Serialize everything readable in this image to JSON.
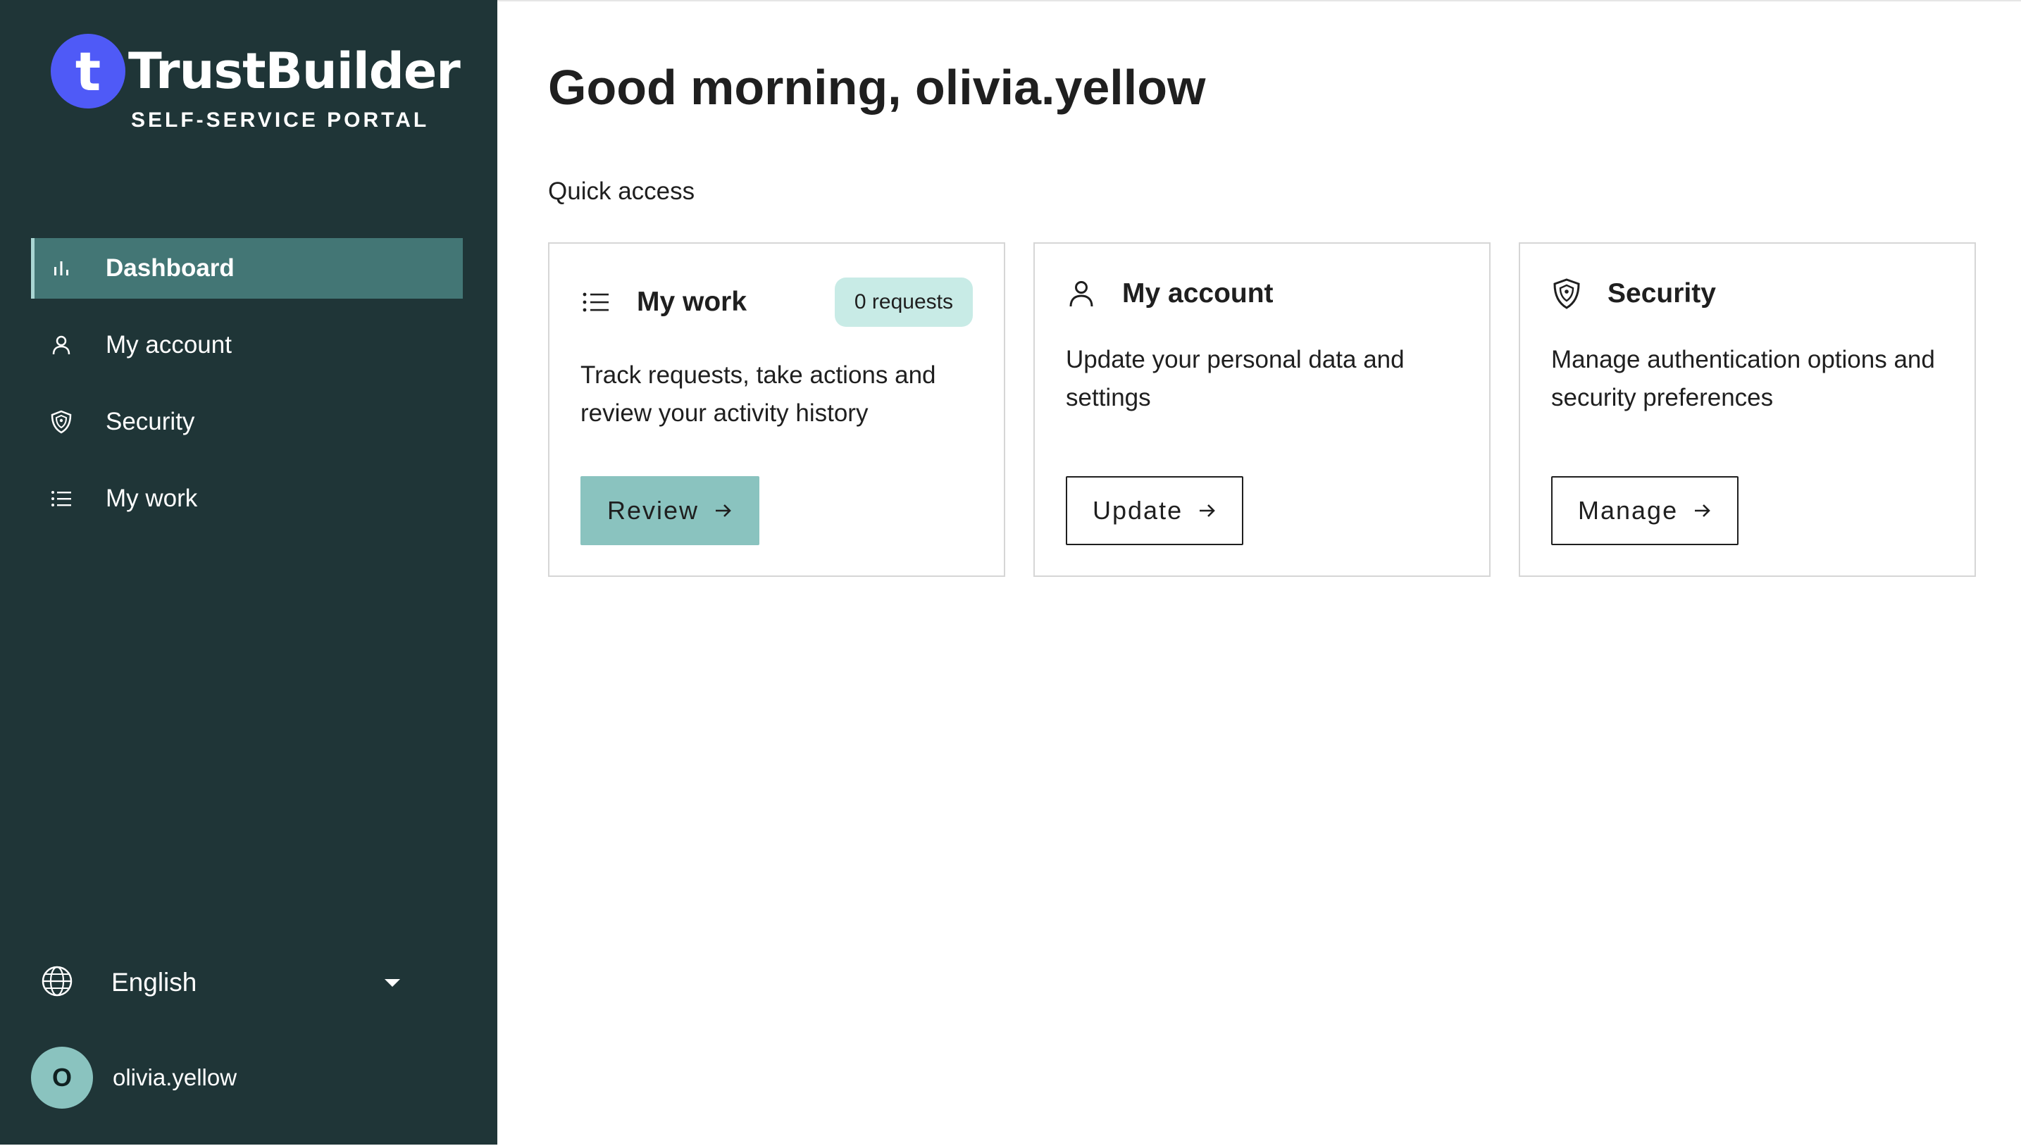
{
  "brand": {
    "mark": "t",
    "name": "TrustBuilder",
    "subtitle": "SELF-SERVICE PORTAL",
    "colors": {
      "sidebar": "#1f3537",
      "mark": "#4f5af7",
      "active": "#437675",
      "accent": "#8ac3bf"
    }
  },
  "sidebar": {
    "items": [
      {
        "label": "Dashboard",
        "icon": "bar-chart-icon",
        "active": true
      },
      {
        "label": "My account",
        "icon": "person-icon",
        "active": false
      },
      {
        "label": "Security",
        "icon": "shield-icon",
        "active": false
      },
      {
        "label": "My work",
        "icon": "list-icon",
        "active": false
      }
    ],
    "language": {
      "label": "English",
      "icon": "globe-icon"
    },
    "user": {
      "initial": "O",
      "name": "olivia.yellow"
    }
  },
  "main": {
    "greeting": "Good morning, olivia.yellow",
    "section_title": "Quick access",
    "cards": [
      {
        "title": "My work",
        "icon": "list-icon",
        "badge": "0 requests",
        "description": "Track requests, take actions and review your activity history",
        "button": "Review"
      },
      {
        "title": "My account",
        "icon": "person-icon",
        "description": "Update your personal data and settings",
        "button": "Update"
      },
      {
        "title": "Security",
        "icon": "shield-icon",
        "description": "Manage authentication options and security preferences",
        "button": "Manage"
      }
    ]
  }
}
